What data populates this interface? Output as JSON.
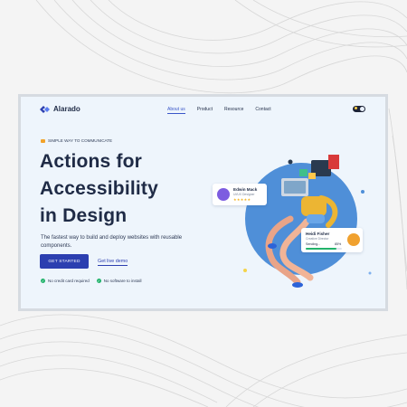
{
  "brand": {
    "name": "Alarado"
  },
  "nav": {
    "items": [
      {
        "label": "About us",
        "active": true
      },
      {
        "label": "Product",
        "active": false
      },
      {
        "label": "Resource",
        "active": false
      },
      {
        "label": "Contact",
        "active": false
      }
    ]
  },
  "theme_toggle": {
    "state": "dark"
  },
  "hero": {
    "eyebrow": "SIMPLE WAY TO COMMUNICATE",
    "headline_lines": [
      "Actions for",
      "Accessibility",
      "in Design"
    ],
    "subtext": "The fastest way to build and deploy websites with reusable components.",
    "primary_cta": "GET STARTED",
    "secondary_cta": "Get live demo",
    "checks": [
      "No credit card required",
      "No software to install"
    ]
  },
  "cards": {
    "edwin": {
      "name": "Edwin Mack",
      "role": "UI/UX Designer",
      "rating": 5
    },
    "heidi": {
      "name": "Heidi Fisher",
      "role": "Creative Director",
      "task": "Sending...",
      "progress_label": "85%",
      "progress": 0.85
    }
  },
  "colors": {
    "primary": "#2c3fb0",
    "heading": "#1f2b46",
    "success": "#22b36b",
    "card_bg": "#eef5fc",
    "circle": "#4f8fd8"
  }
}
